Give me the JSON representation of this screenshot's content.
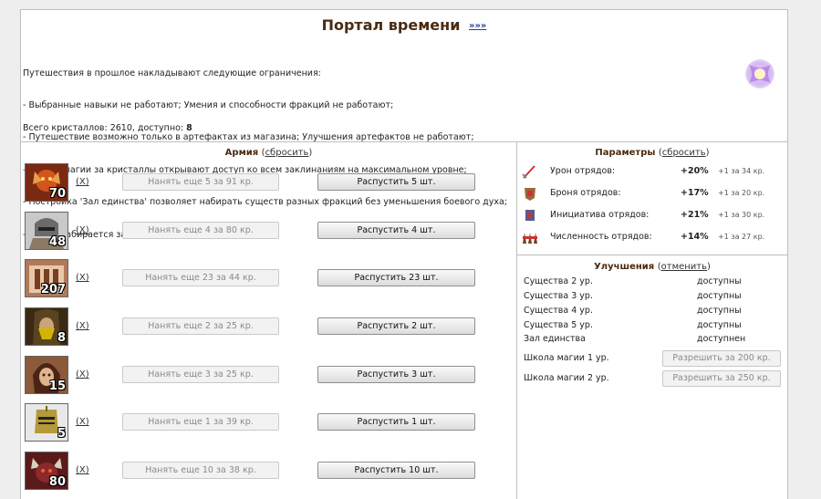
{
  "header": {
    "title": "Портал времени",
    "more_link": "»»»"
  },
  "intro": {
    "lines": [
      "Путешествия в прошлое накладывают следующие ограничения:",
      "- Выбранные навыки не работают; Умения и способности фракций не работают;",
      "- Путешествие возможно только в артефактах из магазина; Улучшения артефактов не работают;",
      "- Школы магии за кристаллы открывают доступ ко всем заклинаниям на максимальном уровне;",
      "- Постройка 'Зал единства' позволяет набирать существ разных фракций без уменьшения боевого духа;",
      "- Армия набирается за кристаллы."
    ],
    "crystals_label": "Всего кристаллов: 2610, доступно:",
    "crystals_available": "8"
  },
  "army": {
    "heading": "Армия",
    "reset_link": "сбросить",
    "units": [
      {
        "count": "70",
        "remove": "X",
        "hire": "Нанять еще 5 за 91 кр.",
        "dismiss": "Распустить 5 шт."
      },
      {
        "count": "48",
        "remove": "X",
        "hire": "Нанять еще 4 за 80 кр.",
        "dismiss": "Распустить 4 шт."
      },
      {
        "count": "207",
        "remove": "X",
        "hire": "Нанять еще 23 за 44 кр.",
        "dismiss": "Распустить 23 шт."
      },
      {
        "count": "8",
        "remove": "X",
        "hire": "Нанять еще 2 за 25 кр.",
        "dismiss": "Распустить 2 шт."
      },
      {
        "count": "15",
        "remove": "X",
        "hire": "Нанять еще 3 за 25 кр.",
        "dismiss": "Распустить 3 шт."
      },
      {
        "count": "5",
        "remove": "X",
        "hire": "Нанять еще 1 за 39 кр.",
        "dismiss": "Распустить 1 шт."
      },
      {
        "count": "80",
        "remove": "X",
        "hire": "Нанять еще 10 за 38 кр.",
        "dismiss": "Распустить 10 шт."
      }
    ]
  },
  "params": {
    "heading": "Параметры",
    "reset_link": "сбросить",
    "rows": [
      {
        "icon": "sword-icon",
        "name": "Урон отрядов:",
        "value": "+20%",
        "cost": "+1 за 34 кр."
      },
      {
        "icon": "armor-icon",
        "name": "Броня отрядов:",
        "value": "+17%",
        "cost": "+1 за 20 кр."
      },
      {
        "icon": "initiative-icon",
        "name": "Инициатива отрядов:",
        "value": "+21%",
        "cost": "+1 за 30 кр."
      },
      {
        "icon": "troops-icon",
        "name": "Численность отрядов:",
        "value": "+14%",
        "cost": "+1 за 27 кр."
      }
    ]
  },
  "upgrades": {
    "heading": "Улучшения",
    "cancel_link": "отменить",
    "rows": [
      {
        "name": "Существа 2 ур.",
        "status": "доступны"
      },
      {
        "name": "Существа 3 ур.",
        "status": "доступны"
      },
      {
        "name": "Существа 4 ур.",
        "status": "доступны"
      },
      {
        "name": "Существа 5 ур.",
        "status": "доступны"
      },
      {
        "name": "Зал единства",
        "status": "доступнен"
      }
    ],
    "magic": [
      {
        "name": "Школа магии 1 ур.",
        "button": "Разрешить за 200 кр."
      },
      {
        "name": "Школа магии 2 ур.",
        "button": "Разрешить за 250 кр."
      }
    ]
  },
  "colors": {
    "heading": "#4a2b12",
    "link": "#2a3d9a"
  }
}
